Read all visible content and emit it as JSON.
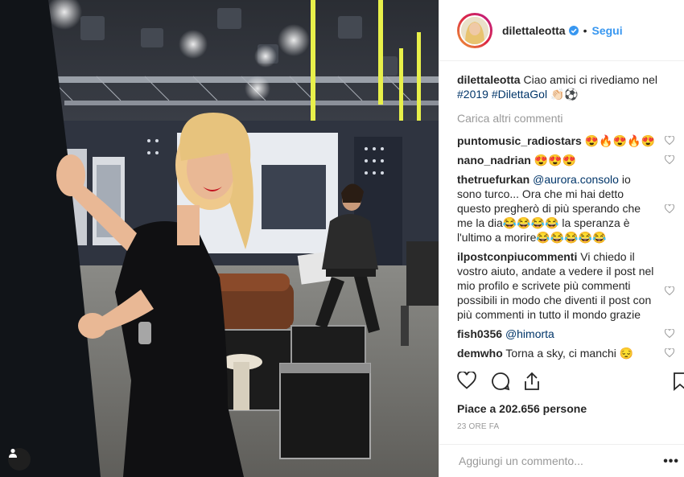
{
  "header": {
    "username": "dilettaleotta",
    "separator": "•",
    "follow_label": "Segui"
  },
  "caption": {
    "username": "dilettaleotta",
    "text": "Ciao amici ci rivediamo nel",
    "hashtags": "#2019 #DilettaGol",
    "emojis": "👏🏻⚽"
  },
  "load_more_label": "Carica altri commenti",
  "comments": [
    {
      "username": "puntomusic_radiostars",
      "text": "😍🔥😍🔥😍"
    },
    {
      "username": "nano_nadrian",
      "text": "😍😍😍"
    },
    {
      "username": "thetruefurkan",
      "mention": "@aurora.consolo",
      "text": "io sono turco... Ora che mi hai detto questo pregherò di più sperando che me la dia😂😂😂😂 la speranza è l'ultimo a morire😂😂😂😂😂"
    },
    {
      "username": "ilpostconpiucommenti",
      "text": "Vi chiedo il vostro aiuto, andate a vedere il post nel mio profilo e scrivete più commenti possibili in modo che diventi il post con più commenti in tutto il mondo grazie"
    },
    {
      "username": "fish0356",
      "mention": "@himorta",
      "text": ""
    },
    {
      "username": "demwho",
      "text": "Torna a sky, ci manchi 😔"
    }
  ],
  "likes_label": "Piace a 202.656 persone",
  "time_label": "23 ORE FA",
  "add_comment_placeholder": "Aggiungi un commento...",
  "more_options_label": "•••",
  "icons": {
    "like": "heart-icon",
    "comment": "comment-icon",
    "share": "share-icon",
    "save": "bookmark-icon",
    "verified": "verified-badge-icon",
    "tag": "user-tag-icon"
  },
  "colors": {
    "follow": "#3897f0",
    "hashtag": "#003569",
    "muted": "#999999",
    "border": "#efefef"
  }
}
